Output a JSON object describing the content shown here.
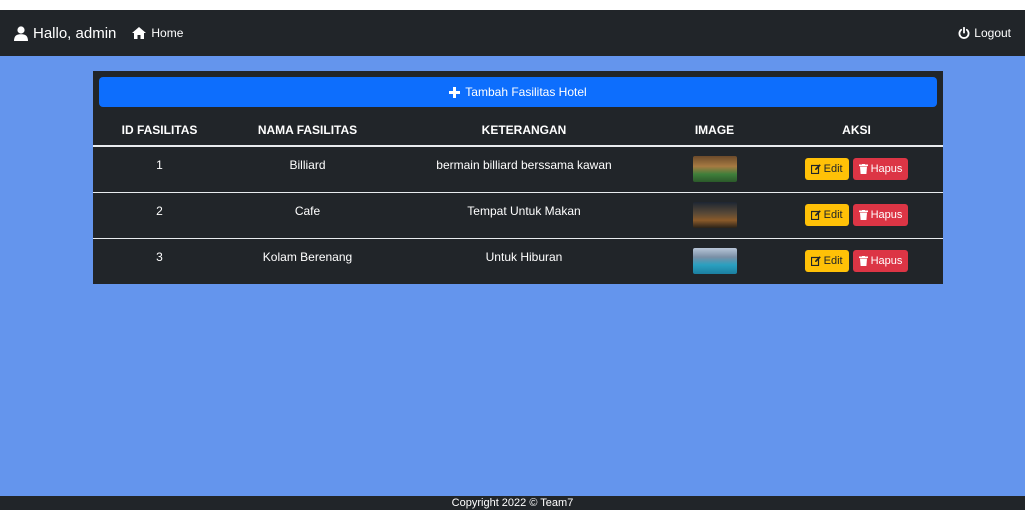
{
  "navbar": {
    "greeting": "Hallo, admin",
    "home_label": "Home",
    "logout_label": "Logout"
  },
  "panel": {
    "add_button_label": "Tambah Fasilitas Hotel"
  },
  "table": {
    "headers": [
      "ID FASILITAS",
      "NAMA FASILITAS",
      "KETERANGAN",
      "IMAGE",
      "AKSI"
    ],
    "rows": [
      {
        "id": "1",
        "name": "Billiard",
        "desc": "bermain billiard berssama kawan",
        "image": "billiard-photo"
      },
      {
        "id": "2",
        "name": "Cafe",
        "desc": "Tempat Untuk Makan",
        "image": "cafe-photo"
      },
      {
        "id": "3",
        "name": "Kolam Berenang",
        "desc": "Untuk Hiburan",
        "image": "pool-photo"
      }
    ],
    "edit_label": "Edit",
    "delete_label": "Hapus"
  },
  "footer": {
    "text": "Copyright 2022 © Team7"
  },
  "colors": {
    "background": "#6495ed",
    "navbar": "#212529",
    "primary": "#0d6efd",
    "warning": "#ffc107",
    "danger": "#dc3545"
  },
  "icons": [
    "user-icon",
    "home-icon",
    "power-icon",
    "plus-icon",
    "edit-icon",
    "trash-icon"
  ]
}
